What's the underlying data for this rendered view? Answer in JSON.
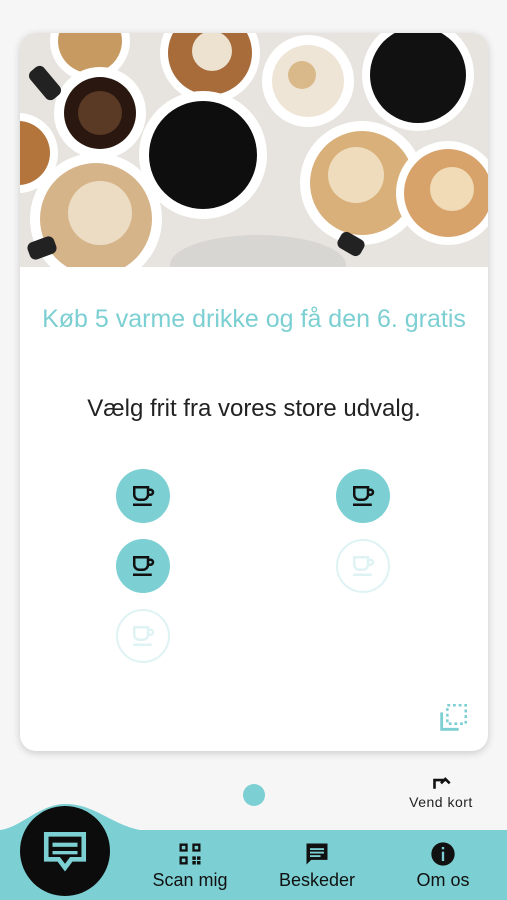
{
  "card": {
    "title": "Køb 5 varme drikke og få den 6. gratis",
    "subtitle": "Vælg frit fra vores store udvalg.",
    "stamps": [
      {
        "state": "filled"
      },
      {
        "state": "filled"
      },
      {
        "state": "filled"
      },
      {
        "state": "empty"
      },
      {
        "state": "empty"
      }
    ]
  },
  "flip": {
    "label": "Vend kort",
    "icon": "flip-arrow-icon"
  },
  "nav": {
    "scan": {
      "label": "Scan mig",
      "icon": "qr-code-icon"
    },
    "messages": {
      "label": "Beskeder",
      "icon": "message-icon"
    },
    "about": {
      "label": "Om os",
      "icon": "info-icon"
    },
    "main": {
      "icon": "loyalty-card-icon"
    }
  },
  "colors": {
    "accent": "#7ccfd2",
    "accent_light": "#dff3f4",
    "dark": "#0c0c0c"
  }
}
